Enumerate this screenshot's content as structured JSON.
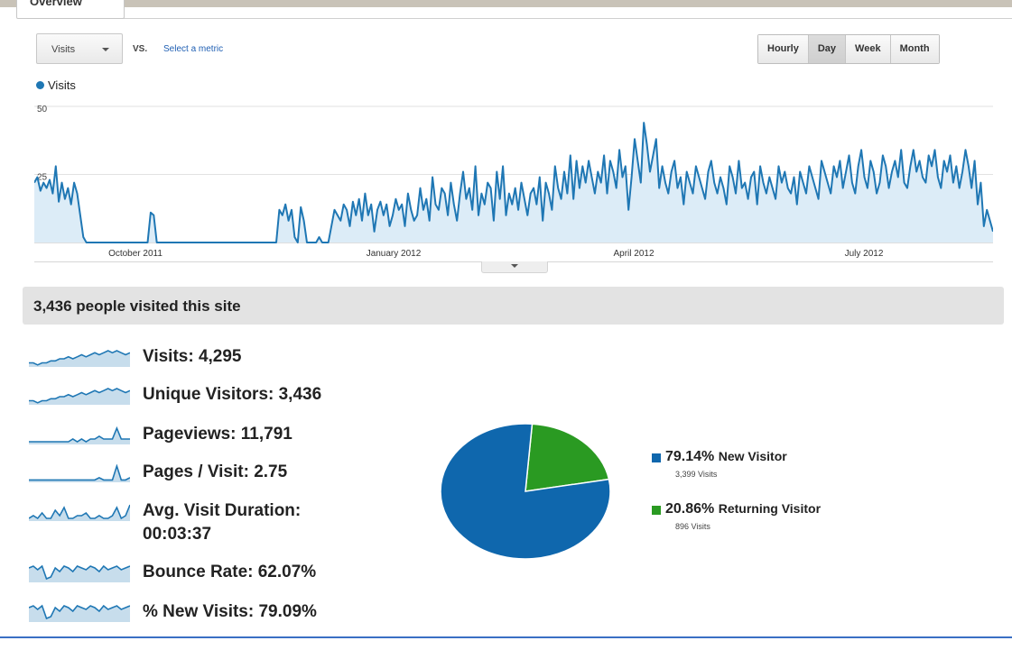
{
  "tab": {
    "label": "Overview"
  },
  "toolbar": {
    "metric_dropdown": "Visits",
    "vs_label": "VS.",
    "select_metric": "Select a metric",
    "periods": [
      "Hourly",
      "Day",
      "Week",
      "Month"
    ],
    "active_period": "Day"
  },
  "chart_data": {
    "type": "area",
    "series": [
      {
        "name": "Visits",
        "color": "#1f77b4"
      }
    ],
    "y_ticks": [
      "50",
      "25"
    ],
    "ylim": [
      0,
      50
    ],
    "x_labels": [
      "October 2011",
      "January 2012",
      "April 2012",
      "July 2012"
    ],
    "values": [
      22,
      24,
      19,
      22,
      20,
      23,
      18,
      28,
      15,
      22,
      16,
      20,
      14,
      22,
      18,
      10,
      2,
      0,
      0,
      0,
      0,
      0,
      0,
      0,
      0,
      0,
      0,
      0,
      0,
      0,
      0,
      0,
      0,
      0,
      0,
      0,
      0,
      0,
      11,
      10,
      0,
      0,
      0,
      0,
      0,
      0,
      0,
      0,
      0,
      0,
      0,
      0,
      0,
      0,
      0,
      0,
      0,
      0,
      0,
      0,
      0,
      0,
      0,
      0,
      0,
      0,
      0,
      0,
      0,
      0,
      0,
      0,
      0,
      0,
      0,
      0,
      0,
      0,
      0,
      0,
      12,
      10,
      14,
      8,
      12,
      2,
      0,
      13,
      8,
      0,
      0,
      0,
      0,
      2,
      0,
      0,
      0,
      6,
      12,
      10,
      8,
      14,
      12,
      6,
      15,
      10,
      16,
      8,
      18,
      10,
      14,
      4,
      12,
      15,
      10,
      14,
      6,
      10,
      16,
      12,
      14,
      6,
      18,
      12,
      8,
      10,
      20,
      12,
      16,
      8,
      24,
      14,
      12,
      20,
      18,
      10,
      22,
      14,
      8,
      18,
      26,
      16,
      20,
      12,
      28,
      10,
      18,
      14,
      22,
      20,
      8,
      26,
      16,
      28,
      10,
      18,
      14,
      20,
      12,
      22,
      16,
      10,
      18,
      20,
      14,
      24,
      8,
      22,
      18,
      12,
      28,
      20,
      16,
      26,
      18,
      32,
      16,
      30,
      20,
      28,
      22,
      30,
      24,
      18,
      26,
      22,
      32,
      18,
      30,
      26,
      20,
      34,
      24,
      28,
      12,
      24,
      38,
      30,
      22,
      44,
      36,
      26,
      32,
      38,
      20,
      28,
      22,
      18,
      26,
      30,
      20,
      24,
      14,
      26,
      22,
      18,
      28,
      24,
      20,
      16,
      26,
      30,
      22,
      18,
      24,
      20,
      14,
      28,
      24,
      18,
      30,
      20,
      22,
      16,
      24,
      26,
      14,
      28,
      22,
      18,
      24,
      20,
      16,
      28,
      22,
      26,
      20,
      18,
      24,
      14,
      26,
      22,
      18,
      28,
      24,
      20,
      16,
      30,
      26,
      22,
      18,
      28,
      24,
      30,
      20,
      26,
      32,
      22,
      18,
      28,
      34,
      24,
      20,
      30,
      26,
      18,
      22,
      32,
      28,
      20,
      26,
      30,
      24,
      34,
      22,
      20,
      28,
      34,
      26,
      30,
      24,
      22,
      32,
      28,
      34,
      24,
      20,
      30,
      26,
      32,
      22,
      28,
      20,
      26,
      34,
      28,
      20,
      30,
      14,
      22,
      6,
      12,
      8,
      4
    ]
  },
  "summary": {
    "title": "3,436 people visited this site"
  },
  "stats": [
    {
      "text": "Visits: 4,295",
      "spark": [
        2,
        2,
        1,
        2,
        2,
        3,
        3,
        4,
        4,
        5,
        4,
        5,
        6,
        5,
        6,
        7,
        6,
        7,
        8,
        7,
        8,
        7,
        6,
        7
      ]
    },
    {
      "text": "Unique Visitors: 3,436",
      "spark": [
        2,
        2,
        1,
        2,
        2,
        3,
        3,
        4,
        4,
        5,
        4,
        5,
        6,
        5,
        6,
        7,
        6,
        7,
        8,
        7,
        8,
        7,
        6,
        7
      ]
    },
    {
      "text": "Pageviews: 11,791",
      "spark": [
        1,
        1,
        1,
        1,
        1,
        1,
        1,
        1,
        1,
        1,
        2,
        1,
        2,
        1,
        2,
        2,
        3,
        2,
        2,
        2,
        6,
        2,
        2,
        2
      ]
    },
    {
      "text": "Pages / Visit: 2.75",
      "spark": [
        1,
        1,
        1,
        1,
        1,
        1,
        1,
        1,
        1,
        1,
        1,
        1,
        1,
        1,
        1,
        1,
        2,
        1,
        1,
        1,
        7,
        1,
        1,
        2
      ]
    },
    {
      "text": "Avg. Visit Duration:",
      "text2": "00:03:37",
      "spark": [
        1,
        2,
        1,
        3,
        1,
        1,
        4,
        2,
        5,
        1,
        1,
        2,
        2,
        3,
        1,
        1,
        2,
        1,
        1,
        2,
        5,
        1,
        2,
        6
      ]
    },
    {
      "text": "Bounce Rate: 62.07%",
      "spark": [
        8,
        9,
        7,
        9,
        2,
        3,
        8,
        6,
        9,
        8,
        6,
        9,
        8,
        7,
        9,
        8,
        6,
        9,
        7,
        8,
        9,
        7,
        8,
        9
      ]
    },
    {
      "text": "% New Visits: 79.09%",
      "spark": [
        8,
        9,
        7,
        9,
        2,
        3,
        8,
        6,
        9,
        8,
        6,
        9,
        8,
        7,
        9,
        8,
        6,
        9,
        7,
        8,
        9,
        7,
        8,
        9
      ]
    }
  ],
  "pie": {
    "slices": [
      {
        "label": "New Visitor",
        "pct_text": "79.14%",
        "value": 79.14,
        "visits_text": "3,399 Visits",
        "color": "#0f67ad"
      },
      {
        "label": "Returning Visitor",
        "pct_text": "20.86%",
        "value": 20.86,
        "visits_text": "896 Visits",
        "color": "#2a9a22"
      }
    ]
  }
}
